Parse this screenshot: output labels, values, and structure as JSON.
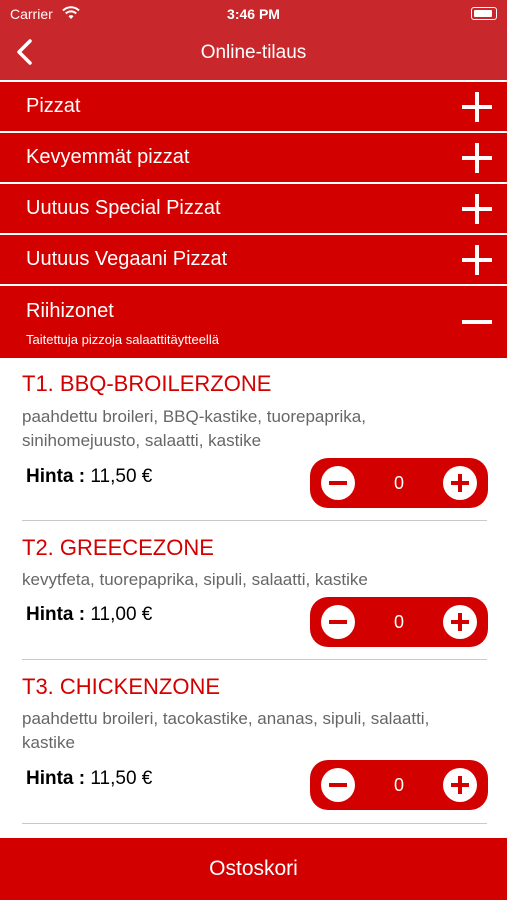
{
  "status": {
    "carrier": "Carrier",
    "time": "3:46 PM"
  },
  "nav": {
    "title": "Online-tilaus"
  },
  "categories": [
    {
      "label": "Pizzat",
      "state": "+"
    },
    {
      "label": "Kevyemmät pizzat",
      "state": "+"
    },
    {
      "label": "Uutuus Special Pizzat",
      "state": "+"
    },
    {
      "label": "Uutuus Vegaani Pizzat",
      "state": "+"
    },
    {
      "label": "Riihizonet",
      "subtitle": "Taitettuja pizzoja salaattitäytteellä",
      "state": "−"
    }
  ],
  "items": [
    {
      "name": "T1. BBQ-BROILERZONE",
      "desc": "paahdettu broileri, BBQ-kastike, tuorepaprika, sinihomejuusto, salaatti, kastike",
      "price_label": "Hinta :",
      "price": "11,50 €",
      "qty": "0"
    },
    {
      "name": "T2. GREECEZONE",
      "desc": "kevytfeta, tuorepaprika, sipuli, salaatti, kastike",
      "price_label": "Hinta :",
      "price": "11,00 €",
      "qty": "0"
    },
    {
      "name": "T3. CHICKENZONE",
      "desc": "paahdettu broileri, tacokastike, ananas, sipuli, salaatti, kastike",
      "price_label": "Hinta :",
      "price": "11,50 €",
      "qty": "0"
    }
  ],
  "cart": {
    "label": "Ostoskori"
  },
  "colors": {
    "primary": "#d30000",
    "nav": "#c8282b"
  }
}
